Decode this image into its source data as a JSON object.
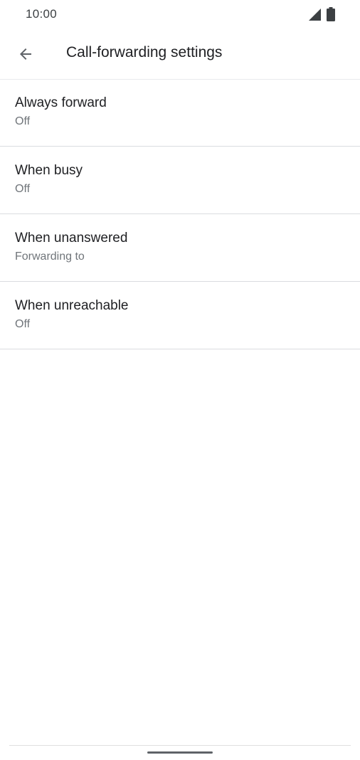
{
  "status_bar": {
    "time": "10:00",
    "signal_icon": "cell-signal-icon",
    "battery_icon": "battery-icon"
  },
  "app_bar": {
    "back_icon": "arrow-back-icon",
    "title": "Call-forwarding settings"
  },
  "settings": [
    {
      "title": "Always forward",
      "summary": "Off"
    },
    {
      "title": "When busy",
      "summary": "Off"
    },
    {
      "title": "When unanswered",
      "summary": "Forwarding to"
    },
    {
      "title": "When unreachable",
      "summary": "Off"
    }
  ],
  "colors": {
    "primary_text": "#202124",
    "secondary_text": "#70757a",
    "divider": "#dadce0",
    "background": "#ffffff"
  }
}
